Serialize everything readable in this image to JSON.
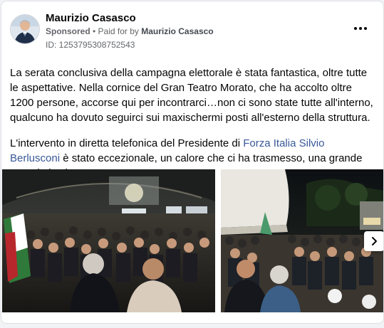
{
  "post": {
    "author": "Maurizio Casasco",
    "sponsored_label": "Sponsored",
    "separator": " • ",
    "paid_for_prefix": "Paid for by ",
    "payer": "Maurizio Casasco",
    "ad_id": "ID: 1253795308752543",
    "paragraph1": "La serata conclusiva della campagna elettorale è stata fantastica, oltre tutte le aspettative. Nella cornice del Gran Teatro Morato, che ha accolto oltre 1200 persone, accorse qui per incontrarci…non ci sono state tutte all'interno, qualcuno ha dovuto seguirci sui maxischermi posti all'esterno della struttura.",
    "paragraph2_start": "L'intervento in diretta telefonica del Presidente di ",
    "link_party": "Forza Italia",
    "paragraph2_space": " ",
    "link_person": "Silvio Berlusconi",
    "paragraph2_end": " è stato eccezionale, un calore che ci ha trasmesso, una grande energia in vista…"
  },
  "icons": {
    "more": "more-options-icon",
    "next": "chevron-right-icon"
  },
  "colors": {
    "link": "#385898",
    "meta_text": "#65676b",
    "card_border": "#dddfe2"
  }
}
